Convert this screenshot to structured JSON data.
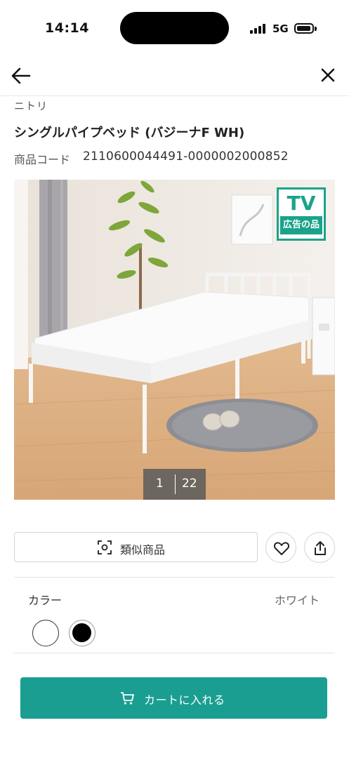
{
  "status_bar": {
    "time": "14:14",
    "network": "5G"
  },
  "nav": {
    "back_icon": "arrow-left-icon",
    "close_icon": "close-icon"
  },
  "product": {
    "brand": "ニトリ",
    "title": "シングルパイプベッド (バジーナF WH)",
    "code_label": "商品コード",
    "code_value": "2110600044491-0000002000852",
    "badge_line1": "TV",
    "badge_line2": "広告の品",
    "image_index": "1",
    "image_total": "22"
  },
  "actions": {
    "similar_label": "類似商品",
    "similar_icon": "camera-scan-icon",
    "favorite_icon": "heart-icon",
    "share_icon": "share-icon"
  },
  "color_section": {
    "label": "カラー",
    "selected_value": "ホワイト",
    "swatches": [
      {
        "name": "white",
        "color": "#ffffff"
      },
      {
        "name": "black",
        "color": "#000000"
      }
    ]
  },
  "cart": {
    "label": "カートに入れる",
    "icon": "cart-icon",
    "color": "#1a9e91"
  }
}
